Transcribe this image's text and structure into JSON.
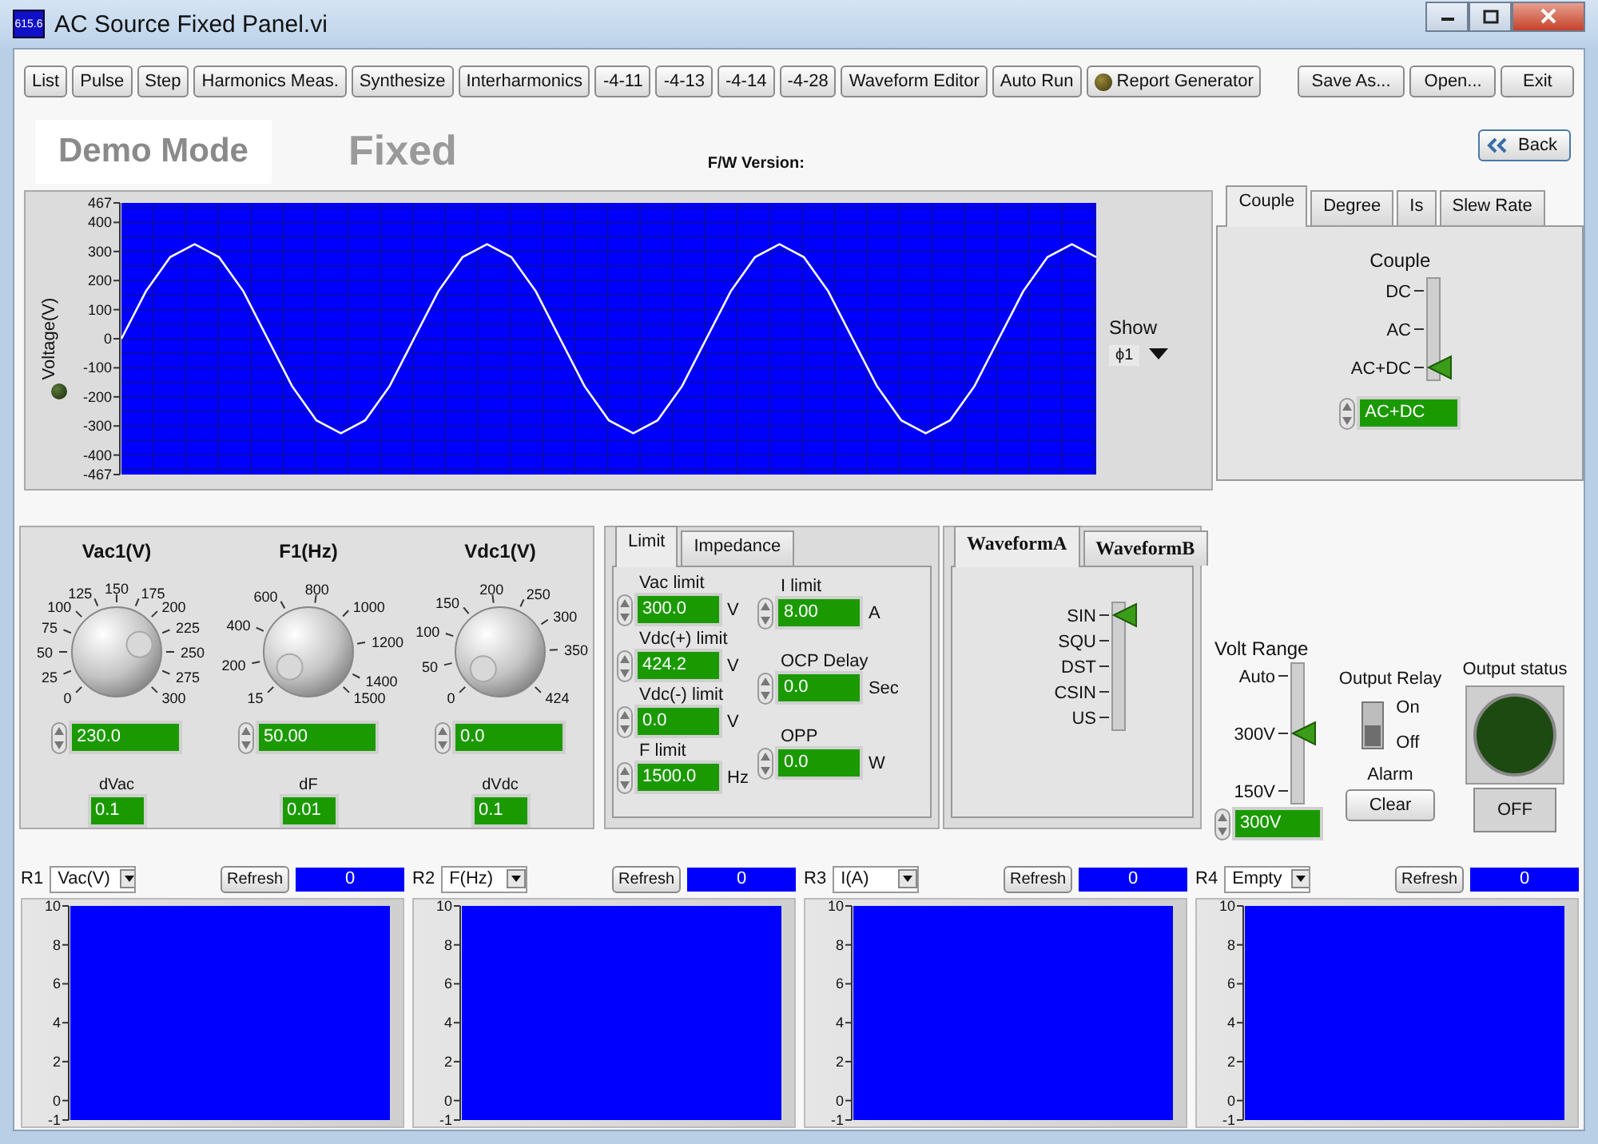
{
  "window": {
    "title": "AC Source Fixed Panel.vi",
    "icon_text": "615.6"
  },
  "toolbar": {
    "buttons": [
      {
        "label": "List",
        "kind": "plain"
      },
      {
        "label": "Pulse",
        "kind": "plain"
      },
      {
        "label": "Step",
        "kind": "plain"
      },
      {
        "label": "Harmonics Meas.",
        "kind": "plain"
      },
      {
        "label": "Synthesize",
        "kind": "plain"
      },
      {
        "label": "Interharmonics",
        "kind": "plain"
      },
      {
        "label": "-4-11",
        "kind": "plain"
      },
      {
        "label": "-4-13",
        "kind": "plain"
      },
      {
        "label": "-4-14",
        "kind": "plain"
      },
      {
        "label": "-4-28",
        "kind": "plain"
      },
      {
        "label": "Waveform Editor",
        "kind": "plain"
      },
      {
        "label": "Auto Run",
        "kind": "plain"
      },
      {
        "label": "Report Generator",
        "kind": "led"
      }
    ],
    "file_buttons": [
      "Save As...",
      "Open..."
    ],
    "exit_button": "Exit"
  },
  "header": {
    "mode": "Demo Mode",
    "panel_name": "Fixed",
    "fw_label": "F/W Version:",
    "back_button": "Back"
  },
  "waveform_graph": {
    "show_label": "Show",
    "show_value": "ϕ1",
    "chart_data": {
      "type": "line",
      "grid": true,
      "ylabel": "Voltage(V)",
      "ylim": [
        -467,
        467
      ],
      "yticks": [
        -467,
        -400,
        -300,
        -200,
        -100,
        0,
        100,
        200,
        300,
        400,
        467
      ],
      "series": [
        {
          "color": "#ffffff",
          "values": [
            0,
            163,
            281,
            325,
            281,
            163,
            0,
            -163,
            -281,
            -325,
            -281,
            -163,
            0,
            163,
            281,
            325,
            281,
            163,
            0,
            -163,
            -281,
            -325,
            -281,
            -163,
            0,
            163,
            281,
            325,
            281,
            163,
            0,
            -163,
            -281,
            -325,
            -281,
            -163,
            0,
            163,
            281,
            325,
            281
          ]
        }
      ]
    }
  },
  "couple": {
    "tabs": [
      {
        "label": "Couple",
        "selected": true
      },
      {
        "label": "Degree",
        "selected": false
      },
      {
        "label": "Is",
        "selected": false
      },
      {
        "label": "Slew Rate",
        "selected": false
      }
    ],
    "title": "Couple",
    "options": [
      {
        "label": "DC",
        "selected": false
      },
      {
        "label": "AC",
        "selected": false
      },
      {
        "label": "AC+DC",
        "selected": true
      }
    ],
    "display": "AC+DC"
  },
  "knobs": [
    {
      "label": "Vac1(V)",
      "scale": [
        "125",
        "150",
        "175",
        "100",
        "200",
        "75",
        "225",
        "50",
        "250",
        "25",
        "275",
        "0",
        "300"
      ],
      "value": "230.0",
      "step_label": "dVac",
      "step": "0.1"
    },
    {
      "label": "F1(Hz)",
      "scale": [
        "15",
        "200",
        "400",
        "600",
        "800",
        "1000",
        "1200",
        "1400",
        "1500"
      ],
      "value": "50.00",
      "step_label": "dF",
      "step": "0.01"
    },
    {
      "label": "Vdc1(V)",
      "scale": [
        "0",
        "50",
        "100",
        "150",
        "200",
        "250",
        "300",
        "350",
        "424"
      ],
      "value": "0.0",
      "step_label": "dVdc",
      "step": "0.1"
    }
  ],
  "limit_panel": {
    "tabs": [
      {
        "label": "Limit",
        "selected": true
      },
      {
        "label": "Impedance",
        "selected": false
      }
    ],
    "left_fields": [
      {
        "label": "Vac limit",
        "value": "300.0",
        "unit": "V"
      },
      {
        "label": "Vdc(+) limit",
        "value": "424.2",
        "unit": "V"
      },
      {
        "label": "Vdc(-) limit",
        "value": "0.0",
        "unit": "V"
      },
      {
        "label": "F limit",
        "value": "1500.0",
        "unit": "Hz"
      }
    ],
    "right_fields": [
      {
        "label": "I limit",
        "value": "8.00",
        "unit": "A"
      },
      {
        "label": "OCP Delay",
        "value": "0.0",
        "unit": "Sec"
      },
      {
        "label": "OPP",
        "value": "0.0",
        "unit": "W"
      }
    ]
  },
  "waveform_panel": {
    "tabs": [
      {
        "label": "WaveformA",
        "selected": true
      },
      {
        "label": "WaveformB",
        "selected": false
      }
    ],
    "options": [
      {
        "label": "SIN",
        "selected": true
      },
      {
        "label": "SQU",
        "selected": false
      },
      {
        "label": "DST",
        "selected": false
      },
      {
        "label": "CSIN",
        "selected": false
      },
      {
        "label": "US",
        "selected": false
      }
    ]
  },
  "volt_range": {
    "title": "Volt Range",
    "options": [
      {
        "label": "Auto",
        "selected": false
      },
      {
        "label": "300V",
        "selected": true
      },
      {
        "label": "150V",
        "selected": false
      }
    ],
    "display": "300V"
  },
  "output_relay": {
    "title": "Output Relay",
    "on_label": "On",
    "off_label": "Off",
    "on": false,
    "alarm_label": "Alarm",
    "clear_button": "Clear"
  },
  "output_status": {
    "title": "Output status",
    "on": false,
    "button": "OFF"
  },
  "reports": [
    {
      "label": "R1",
      "selector": "Vac(V)",
      "refresh": "Refresh",
      "reading": "0",
      "axis_labels": [
        "10",
        "8",
        "6",
        "4",
        "2",
        "0",
        "-1"
      ]
    },
    {
      "label": "R2",
      "selector": "F(Hz)",
      "refresh": "Refresh",
      "reading": "0",
      "axis_labels": [
        "10",
        "8",
        "6",
        "4",
        "2",
        "0",
        "-1"
      ]
    },
    {
      "label": "R3",
      "selector": "I(A)",
      "refresh": "Refresh",
      "reading": "0",
      "axis_labels": [
        "10",
        "8",
        "6",
        "4",
        "2",
        "0",
        "-1"
      ]
    },
    {
      "label": "R4",
      "selector": "Empty",
      "refresh": "Refresh",
      "reading": "0",
      "axis_labels": [
        "10",
        "8",
        "6",
        "4",
        "2",
        "0",
        "-1"
      ]
    }
  ]
}
